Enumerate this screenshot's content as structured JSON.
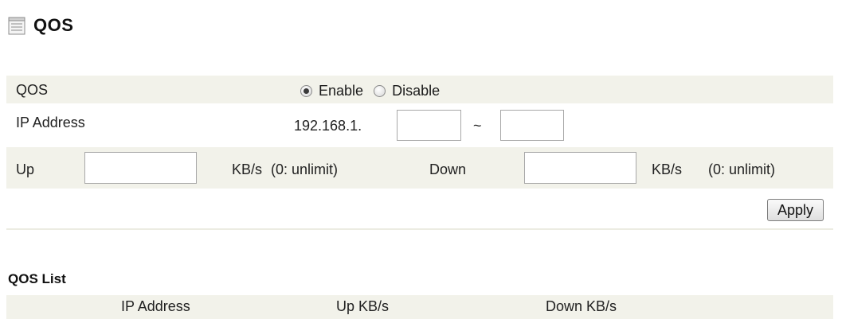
{
  "page": {
    "title": "QOS"
  },
  "form": {
    "qos": {
      "label": "QOS",
      "options": [
        "Enable",
        "Disable"
      ],
      "selected": "Enable"
    },
    "ip": {
      "label": "IP Address",
      "prefix": "192.168.1.",
      "start": "",
      "end": "",
      "separator": "~"
    },
    "up": {
      "label": "Up",
      "value": "",
      "unit": "KB/s",
      "hint": "(0: unlimit)"
    },
    "down": {
      "label": "Down",
      "value": "",
      "unit": "KB/s",
      "hint": "(0: unlimit)"
    },
    "apply_label": "Apply"
  },
  "qos_list": {
    "title": "QOS List",
    "columns": [
      "IP Address",
      "Up KB/s",
      "Down KB/s"
    ]
  },
  "colors": {
    "band": "#f2f2ea",
    "divider": "#ecece2"
  }
}
